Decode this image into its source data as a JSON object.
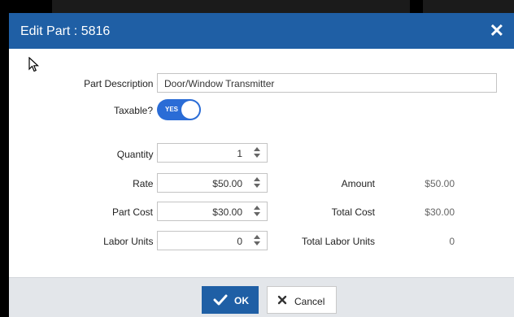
{
  "dialog": {
    "title": "Edit Part : 5816",
    "close_symbol": "✕"
  },
  "fields": {
    "part_description": {
      "label": "Part Description",
      "value": "Door/Window Transmitter",
      "required": true
    },
    "taxable": {
      "label": "Taxable?",
      "toggle_text": "YES",
      "on": true
    },
    "quantity": {
      "label": "Quantity",
      "value": "1",
      "required": true
    },
    "rate": {
      "label": "Rate",
      "value": "$50.00",
      "required": true
    },
    "part_cost": {
      "label": "Part Cost",
      "value": "$30.00",
      "required": false
    },
    "labor_units": {
      "label": "Labor Units",
      "value": "0",
      "required": true
    }
  },
  "summary": {
    "amount": {
      "label": "Amount",
      "value": "$50.00"
    },
    "total_cost": {
      "label": "Total Cost",
      "value": "$30.00"
    },
    "total_labor_units": {
      "label": "Total Labor Units",
      "value": "0"
    }
  },
  "required_marker": "•",
  "buttons": {
    "ok": {
      "label": "OK",
      "icon": "check-icon"
    },
    "cancel": {
      "label": "Cancel",
      "icon": "close-icon"
    }
  },
  "colors": {
    "title_bar": "#1f5fa5",
    "toggle_on": "#2a6cd6",
    "required": "#d0191e",
    "footer": "#e3e6ea"
  }
}
